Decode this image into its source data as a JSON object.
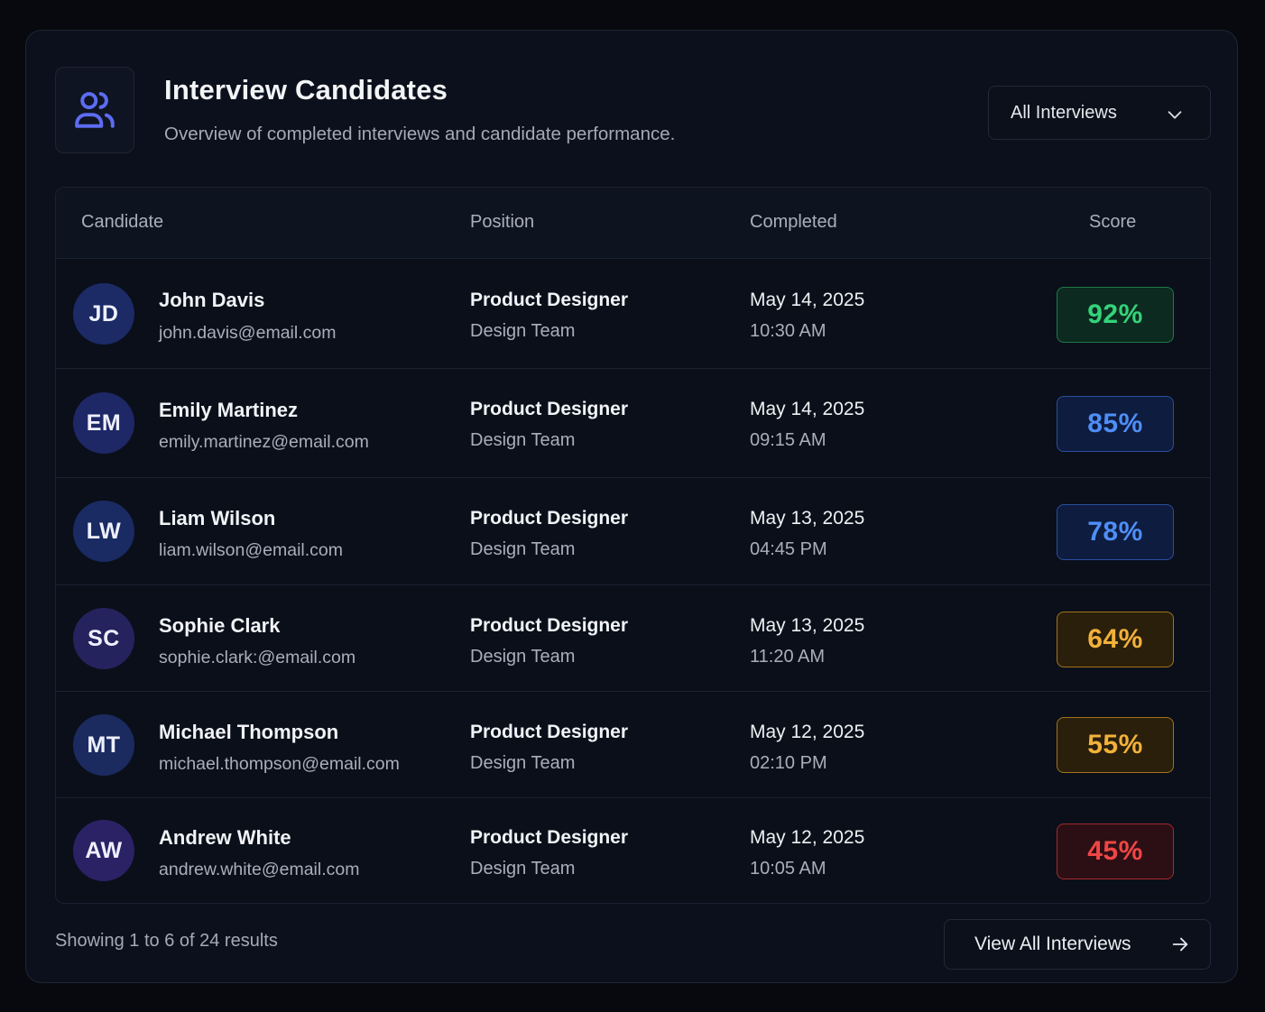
{
  "header": {
    "icon": "users-icon",
    "title": "Interview Candidates",
    "subtitle": "Overview of completed interviews and candidate performance.",
    "filter": {
      "selected": "All Interviews",
      "icon": "chevron-down-icon"
    }
  },
  "table": {
    "columns": {
      "candidate": "Candidate",
      "position": "Position",
      "completed": "Completed",
      "score": "Score"
    },
    "rows": [
      {
        "initials": "JD",
        "name": "John Davis",
        "email": "john.davis@email.com",
        "position": "Product Designer",
        "team": "Design Team",
        "date": "May 14, 2025",
        "time": "10:30 AM",
        "score": "92%",
        "score_color": "#34d37a",
        "score_bg": "#0c2a1f",
        "score_border": "#1f7a46",
        "avatar_bg": "#1c2a66"
      },
      {
        "initials": "EM",
        "name": "Emily Martinez",
        "email": "emily.martinez@email.com",
        "position": "Product Designer",
        "team": "Design Team",
        "date": "May 14, 2025",
        "time": "09:15 AM",
        "score": "85%",
        "score_color": "#4f8ef7",
        "score_bg": "#0d1c3f",
        "score_border": "#2b4f9e",
        "avatar_bg": "#1f2866"
      },
      {
        "initials": "LW",
        "name": "Liam Wilson",
        "email": "liam.wilson@email.com",
        "position": "Product Designer",
        "team": "Design Team",
        "date": "May 13, 2025",
        "time": "04:45 PM",
        "score": "78%",
        "score_color": "#4f8ef7",
        "score_bg": "#0d1c3f",
        "score_border": "#2b4f9e",
        "avatar_bg": "#1a2b63"
      },
      {
        "initials": "SC",
        "name": "Sophie Clark",
        "email": "sophie.clark:@email.com",
        "position": "Product Designer",
        "team": "Design Team",
        "date": "May 13, 2025",
        "time": "11:20 AM",
        "score": "64%",
        "score_color": "#f2b13a",
        "score_bg": "#2a1f0b",
        "score_border": "#a37419",
        "avatar_bg": "#25235e"
      },
      {
        "initials": "MT",
        "name": "Michael Thompson",
        "email": "michael.thompson@email.com",
        "position": "Product Designer",
        "team": "Design Team",
        "date": "May 12, 2025",
        "time": "02:10 PM",
        "score": "55%",
        "score_color": "#f2b13a",
        "score_bg": "#2a1f0b",
        "score_border": "#a37419",
        "avatar_bg": "#1b2b60"
      },
      {
        "initials": "AW",
        "name": "Andrew White",
        "email": "andrew.white@email.com",
        "position": "Product Designer",
        "team": "Design Team",
        "date": "May 12, 2025",
        "time": "10:05 AM",
        "score": "45%",
        "score_color": "#f04646",
        "score_bg": "#2c0f14",
        "score_border": "#a32a2e",
        "avatar_bg": "#2b2266"
      }
    ]
  },
  "footer": {
    "results_text": "Showing 1 to 6 of 24 results",
    "view_all_label": "View All Interviews",
    "view_all_icon": "arrow-right-icon"
  }
}
